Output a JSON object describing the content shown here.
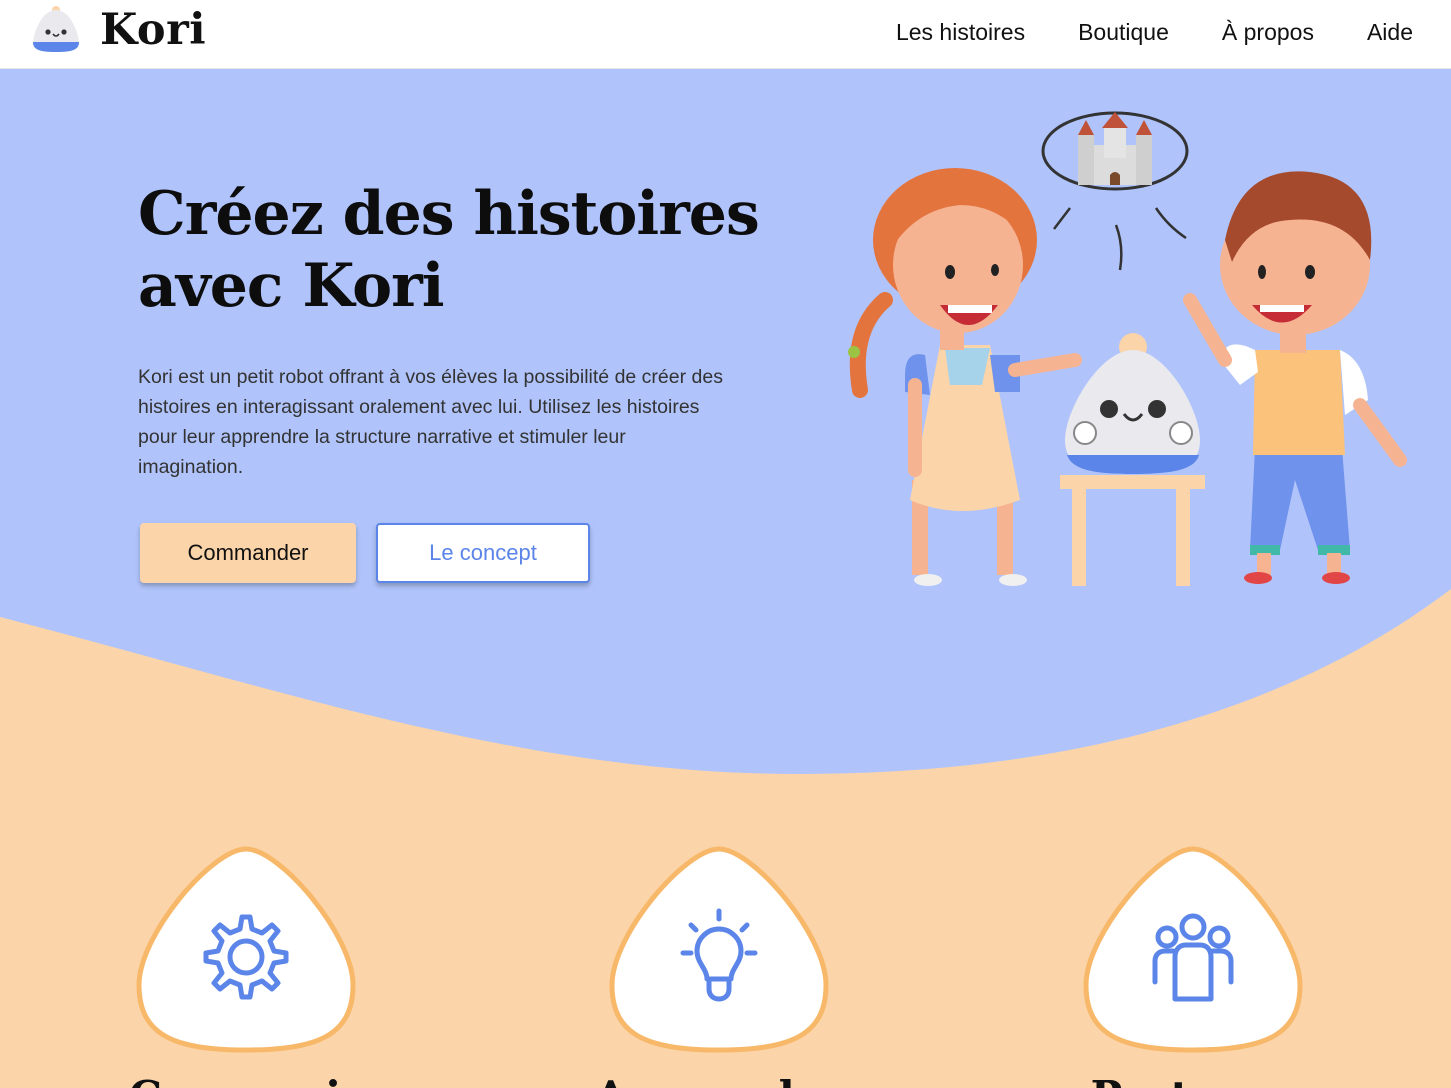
{
  "header": {
    "brand": "Kori",
    "nav": [
      "Les histoires",
      "Boutique",
      "À propos",
      "Aide"
    ]
  },
  "hero": {
    "title_line1": "Créez des histoires",
    "title_line2": "avec Kori",
    "description": "Kori est un petit robot offrant à vos élèves la possibilité de créer des histoires en interagissant oralement avec lui. Utilisez les histoires pour leur apprendre la structure narrative et stimuler leur imagination.",
    "primary_button": "Commander",
    "secondary_button": "Le concept"
  },
  "features": [
    {
      "icon": "gear-icon",
      "title": "Concevoir"
    },
    {
      "icon": "lightbulb-icon",
      "title": "Apprendre"
    },
    {
      "icon": "group-icon",
      "title": "Partager"
    }
  ],
  "colors": {
    "hero_background": "#b0c4fb",
    "peach": "#fbd4a9",
    "accent_blue": "#5b85e8",
    "feature_border": "#f8b86a"
  }
}
